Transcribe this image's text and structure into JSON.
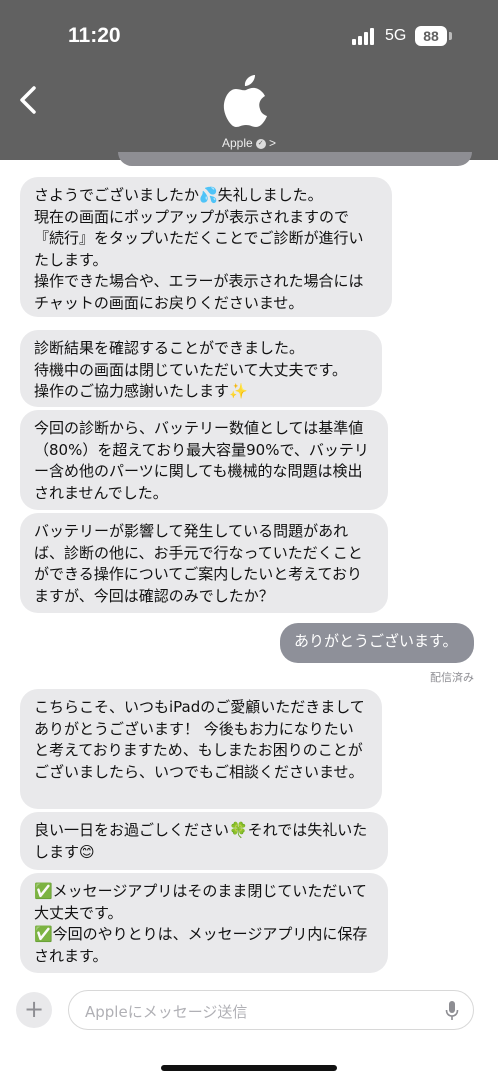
{
  "status_bar": {
    "time": "11:20",
    "network": "5G",
    "battery": "88"
  },
  "header": {
    "contact_name": "Apple",
    "logo_icon": "apple-logo-icon"
  },
  "messages": [
    {
      "from": "them",
      "text": "さようでございましたか💦失礼しました。\n現在の画面にポップアップが表示されますので『続行』をタップいただくことでご診断が進行いたします。\n操作できた場合や、エラーが表示された場合にはチャットの画面にお戻りくださいませ。"
    },
    {
      "from": "them",
      "text": "診断結果を確認することができました。\n待機中の画面は閉じていただいて大丈夫です。\n操作のご協力感謝いたします✨"
    },
    {
      "from": "them",
      "text": "今回の診断から、バッテリー数値としては基準値（80%）を超えており最大容量90%で、バッテリー含め他のパーツに関しても機械的な問題は検出されませんでした。"
    },
    {
      "from": "them",
      "text": "バッテリーが影響して発生している問題があれば、診断の他に、お手元で行なっていただくことができる操作についてご案内したいと考えておりますが、今回は確認のみでしたか？"
    },
    {
      "from": "me",
      "text": "ありがとうございます。"
    },
    {
      "from": "them",
      "text": "こちらこそ、いつもiPadのご愛顧いただきましてありがとうございます！ 今後もお力になりたいと考えておりますため、もしまたお困りのことがございましたら、いつでもご相談くださいませ。"
    },
    {
      "from": "them",
      "text": "良い一日をお過ごしください🍀それでは失礼いたします😊"
    },
    {
      "from": "them",
      "text": "✅メッセージアプリはそのまま閉じていただいて大丈夫です。\n✅今回のやりとりは、メッセージアプリ内に保存されます。"
    }
  ],
  "delivered_label": "配信済み",
  "composer": {
    "placeholder": "Appleにメッセージ送信",
    "add_icon": "plus-icon",
    "mic_icon": "microphone-icon"
  },
  "colors": {
    "header_bg": "#616161",
    "incoming_bubble": "#e9e9eb",
    "outgoing_bubble": "#8e9099"
  }
}
